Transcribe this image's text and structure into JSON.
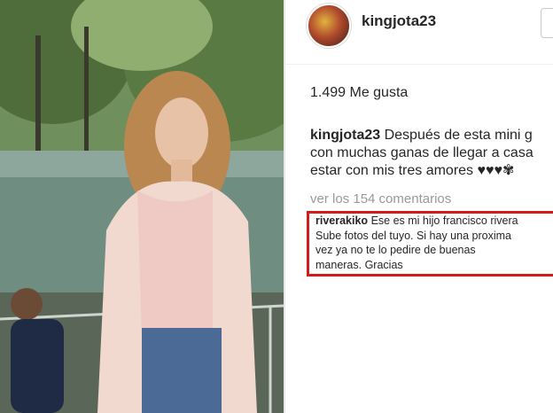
{
  "post": {
    "author": "kingjota23",
    "likes": "1.499 Me gusta",
    "caption_user": "kingjota23",
    "caption_lines": [
      "Después de esta mini g",
      "con muchas ganas de llegar a casa",
      "estar con mis tres amores ♥♥♥✾"
    ],
    "view_comments": "ver los 154 comentarios",
    "comment": {
      "user": "riverakiko",
      "line1": "Ese es mi hijo francisco rivera",
      "line2": "Sube fotos del tuyo. Si hay una proxima",
      "line3": "vez ya no te lo pedire de buenas",
      "line4": "maneras. Gracias"
    }
  },
  "colors": {
    "highlight_border": "#d41b1b",
    "muted_text": "#999999",
    "text": "#262626"
  }
}
